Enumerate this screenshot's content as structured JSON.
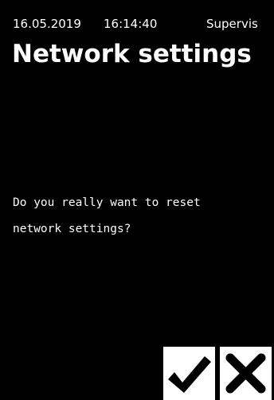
{
  "status_bar": {
    "date": "16.05.2019",
    "time": "16:14:40",
    "user": "Supervis"
  },
  "page": {
    "title": "Network settings"
  },
  "dialog": {
    "message_line_1": "Do you really want to reset",
    "message_line_2": "network settings?"
  },
  "buttons": {
    "confirm_icon": "checkmark-icon",
    "cancel_icon": "x-icon"
  },
  "colors": {
    "background": "#000000",
    "foreground": "#ffffff"
  }
}
